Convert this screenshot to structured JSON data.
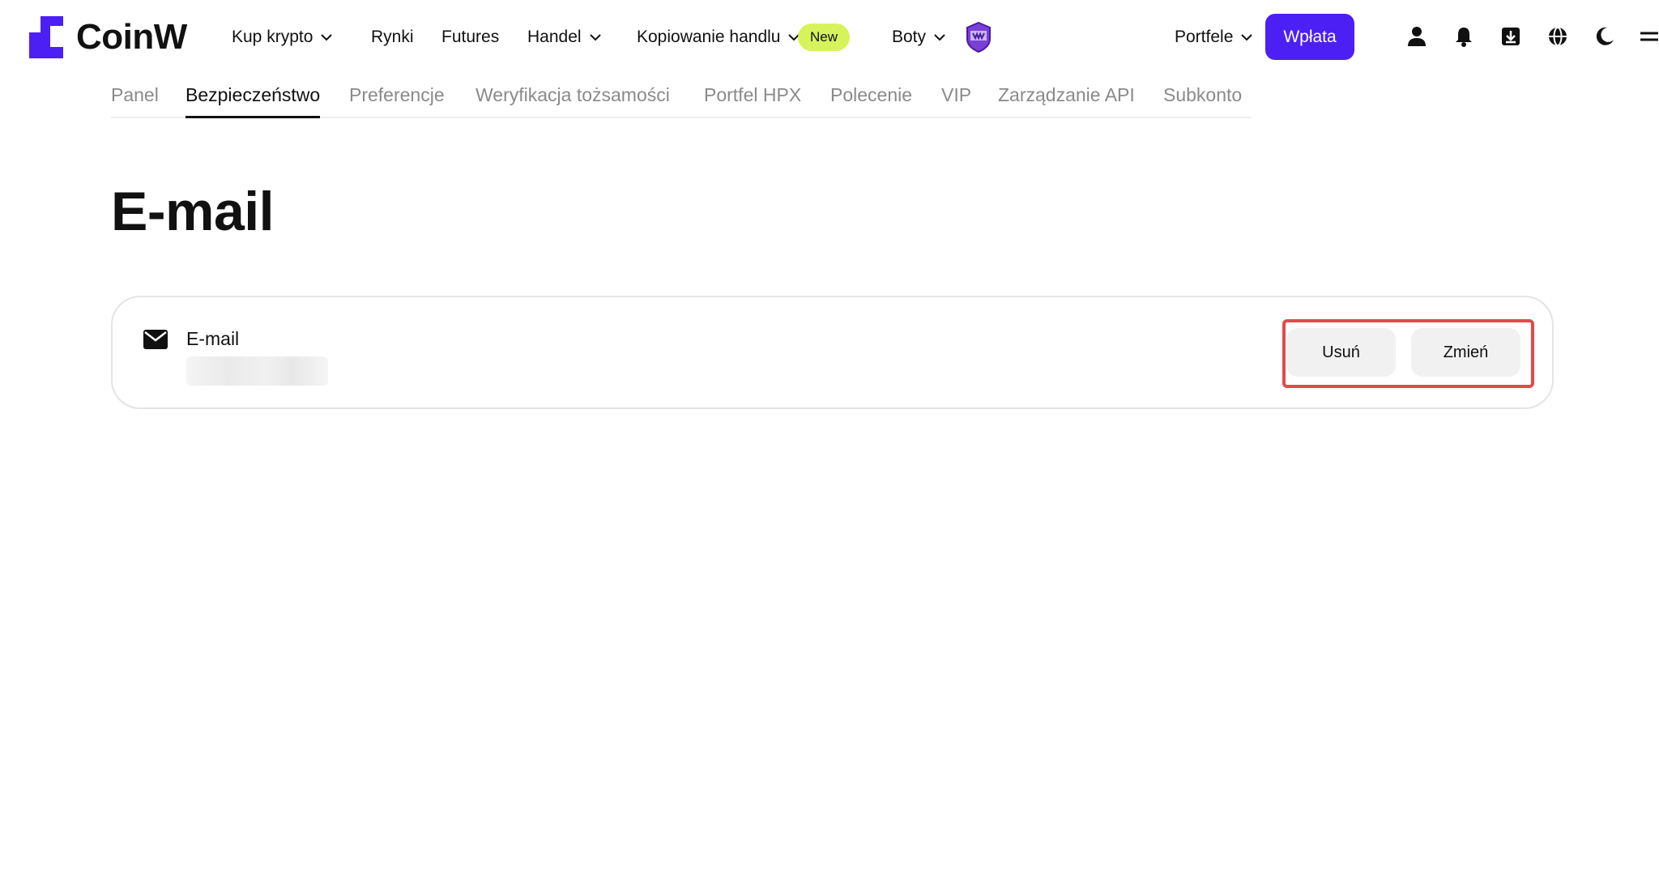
{
  "brand": {
    "name": "CoinW",
    "accent": "#4c1ff5"
  },
  "nav": {
    "buy_crypto": "Kup krypto",
    "markets": "Rynki",
    "futures": "Futures",
    "trade": "Handel",
    "copy_trading": "Kopiowanie handlu",
    "new_badge": "New",
    "bots": "Boty",
    "wallets": "Portfele",
    "deposit": "Wpłata"
  },
  "header_icons": [
    "user-icon",
    "bell-icon",
    "download-icon",
    "globe-icon",
    "moon-icon",
    "menu-icon"
  ],
  "tabs": [
    {
      "label": "Panel"
    },
    {
      "label": "Bezpieczeństwo",
      "active": true
    },
    {
      "label": "Preferencje"
    },
    {
      "label": "Weryfikacja tożsamości"
    },
    {
      "label": "Portfel HPX"
    },
    {
      "label": "Polecenie"
    },
    {
      "label": "VIP"
    },
    {
      "label": "Zarządzanie API"
    },
    {
      "label": "Subkonto"
    }
  ],
  "page": {
    "title": "E-mail"
  },
  "email_card": {
    "label": "E-mail",
    "value": "",
    "remove_button": "Usuń",
    "change_button": "Zmień",
    "highlight_color": "#e5484d"
  }
}
